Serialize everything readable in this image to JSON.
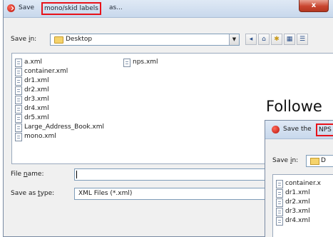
{
  "dialog": {
    "title_prefix": "Save ",
    "title_highlight": "mono/skid labels",
    "title_suffix": " as...",
    "close_label": "x",
    "save_in_label_pre": "Save ",
    "save_in_label_ul": "i",
    "save_in_label_post": "n:",
    "save_in_value": "Desktop",
    "files_col1": [
      "a.xml",
      "container.xml",
      "dr1.xml",
      "dr2.xml",
      "dr3.xml",
      "dr4.xml",
      "dr5.xml",
      "Large_Address_Book.xml",
      "mono.xml"
    ],
    "files_col2": [
      "nps.xml"
    ],
    "file_name_label_pre": "File ",
    "file_name_label_ul": "n",
    "file_name_label_post": "ame:",
    "file_name_value": "",
    "save_as_type_label_pre": "Save as ",
    "save_as_type_label_ul": "t",
    "save_as_type_label_post": "ype:",
    "save_as_type_value": "XML Files (*.xml)"
  },
  "overlay": {
    "caption": "Followe",
    "title_prefix": "Save the ",
    "title_highlight": "NPS",
    "save_in_label_pre": "Save ",
    "save_in_label_ul": "i",
    "save_in_label_post": "n:",
    "save_in_value": "D",
    "files": [
      "container.x",
      "dr1.xml",
      "dr2.xml",
      "dr3.xml",
      "dr4.xml"
    ]
  },
  "colors": {
    "highlight": "#e8121a",
    "titlebar": "#c8d8ec"
  }
}
